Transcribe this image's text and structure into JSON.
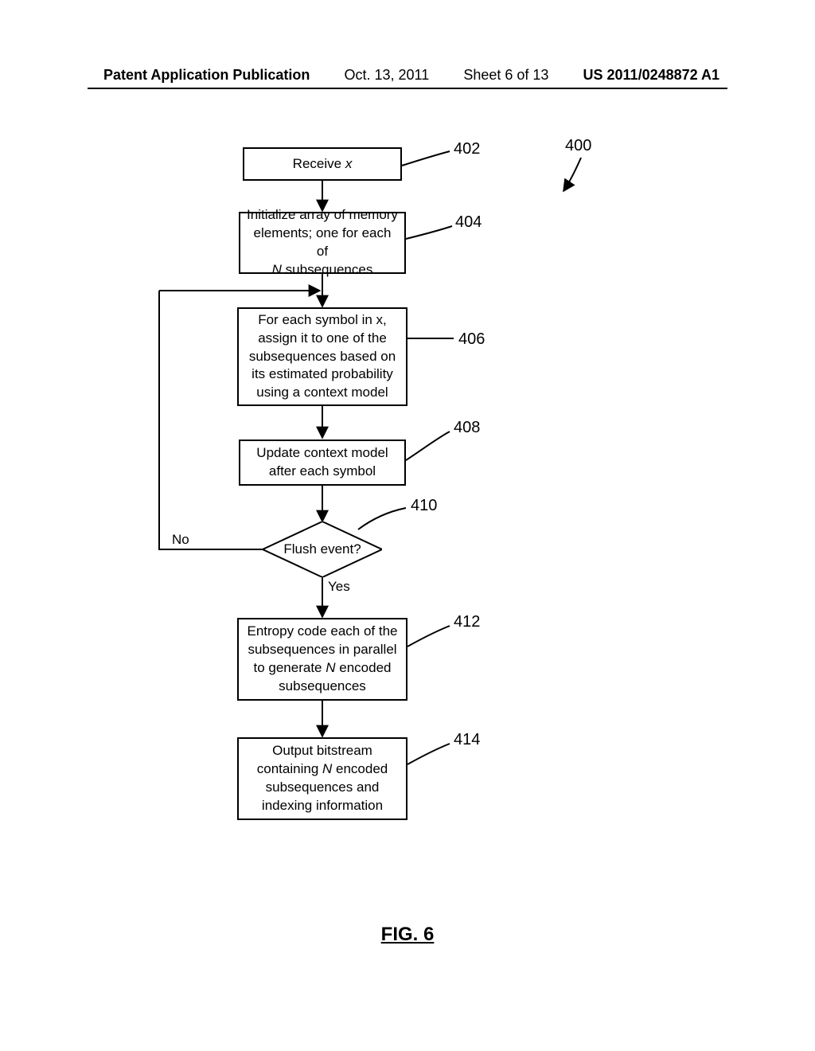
{
  "header": {
    "publication_type": "Patent Application Publication",
    "date": "Oct. 13, 2011",
    "sheet": "Sheet 6 of 13",
    "publication_number": "US 2011/0248872 A1"
  },
  "ref_400": "400",
  "steps": {
    "s402": {
      "ref": "402",
      "pre": "Receive ",
      "italic": "x",
      "post": ""
    },
    "s404": {
      "ref": "404",
      "line1": "Initialize array of memory",
      "line2": "elements; one for each of",
      "italic": "N",
      "line3": " subsequences"
    },
    "s406": {
      "ref": "406",
      "text": "For each symbol in x, assign it to one of the subsequences based on its estimated probability using a context model"
    },
    "s408": {
      "ref": "408",
      "text": "Update context model after each symbol"
    },
    "s410": {
      "ref": "410",
      "text": "Flush event?"
    },
    "s412": {
      "ref": "412",
      "line1": "Entropy code each of the",
      "line2": "subsequences in parallel",
      "line3_pre": "to generate ",
      "italic": "N",
      "line3_post": " encoded",
      "line4": "subsequences"
    },
    "s414": {
      "ref": "414",
      "line1": "Output bitstream",
      "line2_pre": "containing ",
      "italic": "N",
      "line2_post": " encoded",
      "line3": "subsequences and",
      "line4": "indexing information"
    }
  },
  "branches": {
    "yes": "Yes",
    "no": "No"
  },
  "figure_caption": "FIG.  6"
}
